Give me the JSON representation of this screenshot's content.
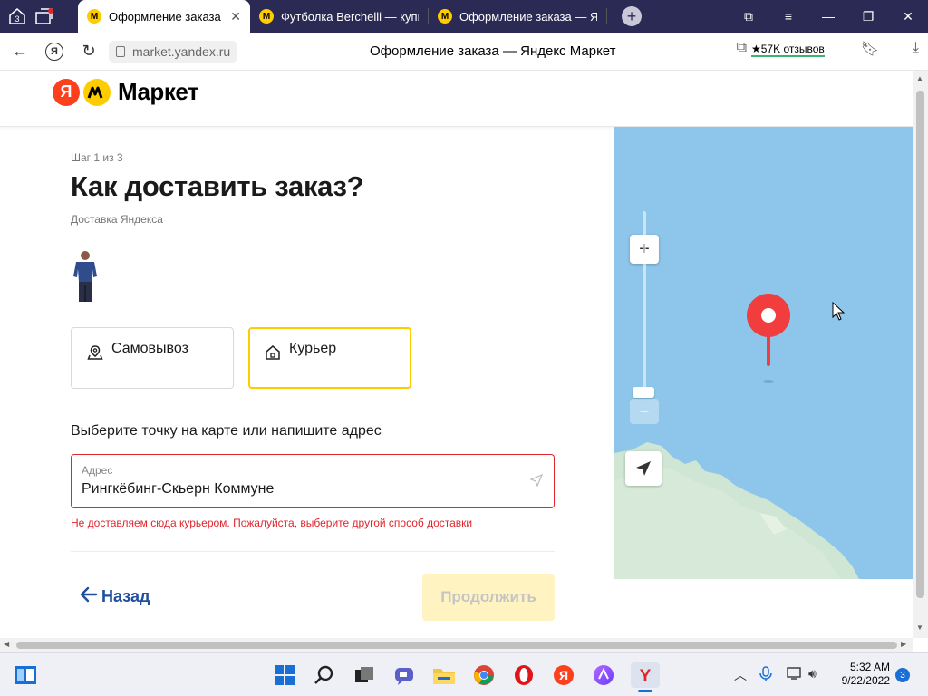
{
  "browser": {
    "tab_counter": "3",
    "tabs": [
      {
        "title": "Оформление заказа —",
        "active": true
      },
      {
        "title": "Футболка Berchelli — купи",
        "active": false
      },
      {
        "title": "Оформление заказа — Ян",
        "active": false
      }
    ],
    "url": "market.yandex.ru",
    "page_title": "Оформление заказа — Яндекс Маркет",
    "reviews_badge": "★57K отзывов"
  },
  "site": {
    "logo_ya": "Я",
    "logo_text": "Маркет"
  },
  "checkout": {
    "step": "Шаг 1 из 3",
    "heading": "Как доставить заказ?",
    "subtitle": "Доставка Яндекса",
    "options": [
      {
        "label": "Самовывоз",
        "icon": "map-pin-icon",
        "selected": false
      },
      {
        "label": "Курьер",
        "icon": "house-icon",
        "selected": true
      }
    ],
    "choose_label": "Выберите точку на карте или напишите адрес",
    "address": {
      "label": "Адрес",
      "value": "Рингкёбинг-Скьерн Коммуне"
    },
    "error": "Не доставляем сюда курьером. Пожалуйста, выберите другой способ доставки",
    "back_label": "Назад",
    "continue_label": "Продолжить"
  },
  "map": {
    "zoom_in": "+",
    "zoom_out": "−"
  },
  "taskbar": {
    "time": "5:32 AM",
    "date": "9/22/2022",
    "notifications": "3"
  },
  "colors": {
    "accent_yellow": "#ffcc00",
    "error_red": "#e0262d",
    "link_blue": "#1f4e9c",
    "map_water": "#8ec5ea",
    "pin_red": "#f13d3d"
  }
}
